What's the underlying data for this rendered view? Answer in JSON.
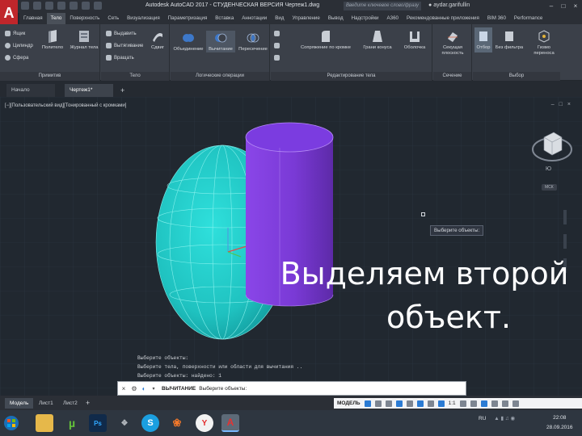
{
  "titlebar": {
    "app_logo": "A",
    "title": "Autodesk AutoCAD 2017 - СТУДЕНЧЕСКАЯ ВЕРСИЯ   Чертеж1.dwg",
    "search_placeholder": "Введите ключевое слово/фразу",
    "user": "aydar.garifullin",
    "window_buttons": [
      "–",
      "□",
      "×"
    ]
  },
  "ribbon_tabs": [
    "Главная",
    "Тело",
    "Поверхность",
    "Сеть",
    "Визуализация",
    "Параметризация",
    "Вставка",
    "Аннотации",
    "Вид",
    "Управление",
    "Вывод",
    "Надстройки",
    "A360",
    "Рекомендованные приложения",
    "BIM 360",
    "Performance"
  ],
  "ribbon": {
    "primitives": {
      "label": "Примитив",
      "small": [
        "Ящик",
        "Цилиндр",
        "Сфера"
      ],
      "big": [
        "Политело",
        "Журнал тела"
      ]
    },
    "solid": {
      "label": "Тело",
      "small": [
        "Выдавить",
        "Вытягивание",
        "Вращать"
      ],
      "big": [
        "Сдвиг"
      ]
    },
    "boolean": {
      "label": "Логические операции",
      "big": [
        "Объединение",
        "Вычитание",
        "Пересечение"
      ]
    },
    "edit": {
      "label": "Редактирование тела",
      "big": [
        "Сопряжение по кромке",
        "Грани конуса",
        "Оболочка"
      ]
    },
    "section": {
      "label": "Сечение",
      "big": [
        "Секущая плоскость"
      ]
    },
    "selection": {
      "label": "Выбор",
      "big": [
        "Отбор",
        "Без фильтра",
        "Гизмо переноса"
      ]
    }
  },
  "file_tabs": {
    "start": "Начало",
    "drawing": "Чертеж1*",
    "plus": "+"
  },
  "viewport": {
    "label": "[−][Пользовательский вид][Тонированный с кромками]",
    "controls": [
      "–",
      "□",
      "×"
    ],
    "viewcube_label": "Ю",
    "wcs": "МСК",
    "tooltip": "Выберите объекты:",
    "overlay_line1": "Выделяем второй",
    "overlay_line2": "объект."
  },
  "command": {
    "history": [
      "Выберите объекты:",
      "Выберите тела, поверхности или области для вычитания ..",
      "Выберите объекты: найдено: 1"
    ],
    "close": "×",
    "wrench": "🔧",
    "prompt_name": "ВЫЧИТАНИЕ",
    "prompt_text": "Выберите объекты:"
  },
  "layout_tabs": {
    "model": "Модель",
    "l1": "Лист1",
    "l2": "Лист2",
    "plus": "+"
  },
  "status": {
    "model": "МОДЕЛЬ",
    "scale": "1:1"
  },
  "taskbar": {
    "lang": "RU",
    "time": "22:08",
    "date": "28.09.2016"
  },
  "colors": {
    "sphere": "#1fc2c0",
    "cylinder": "#7a3ad6",
    "accent": "#2b7bd3"
  }
}
